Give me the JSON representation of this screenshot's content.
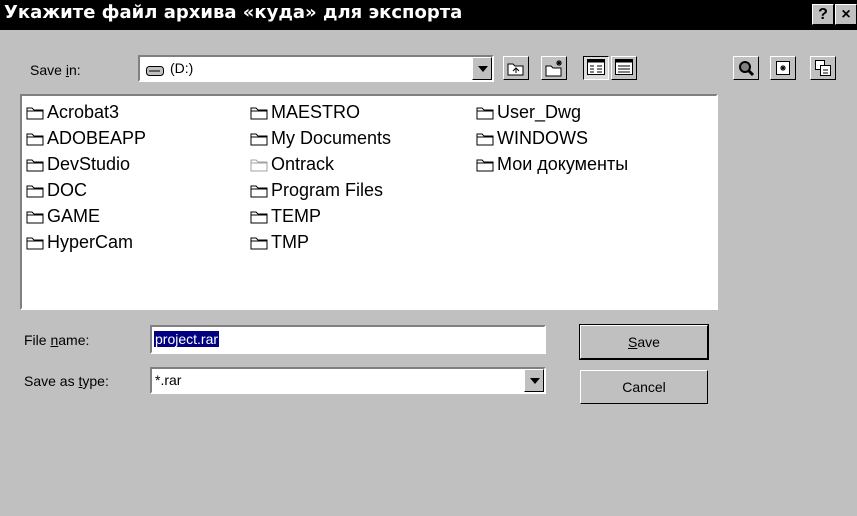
{
  "window": {
    "title": "Укажите файл архива «куда» для экспорта",
    "help_btn": "?",
    "close_btn": "×"
  },
  "savein": {
    "label_pre": "Save ",
    "label_u": "i",
    "label_post": "n:",
    "value": "(D:)"
  },
  "files": {
    "col1": [
      "Acrobat3",
      "ADOBEAPP",
      "DevStudio",
      "DOC",
      "GAME",
      "HyperCam"
    ],
    "col2": [
      "MAESTRO",
      "My Documents",
      "Ontrack",
      "Program Files",
      "TEMP",
      "TMP"
    ],
    "col3": [
      "User_Dwg",
      "WINDOWS",
      "Мои документы"
    ]
  },
  "filename": {
    "label_pre": "File ",
    "label_u": "n",
    "label_post": "ame:",
    "value": "project.rar"
  },
  "savetype": {
    "label_pre": "Save as ",
    "label_u": "t",
    "label_post": "ype:",
    "value": "*.rar"
  },
  "buttons": {
    "save_u": "S",
    "save_rest": "ave",
    "cancel": "Cancel"
  },
  "icons": {
    "drive": "drive-icon",
    "up": "up-folder-icon",
    "newfolder": "new-folder-icon",
    "list": "list-view-icon",
    "details": "details-view-icon",
    "search": "search-icon",
    "extra1": "toolbar-icon-a",
    "extra2": "toolbar-icon-b"
  }
}
